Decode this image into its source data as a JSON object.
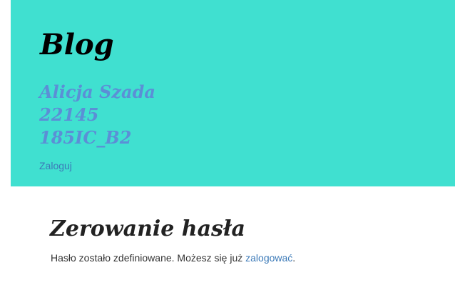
{
  "header": {
    "blog_title": "Blog",
    "author_lines": [
      "Alicja Szada",
      "22145",
      "185IC_B2"
    ],
    "login_link": "Zaloguj",
    "background_color": "#40e0d0"
  },
  "main": {
    "title": "Zerowanie hasła",
    "message_prefix": "Hasło zostało zdefiniowane. Możesz się już ",
    "message_link": "zalogować",
    "message_suffix": "."
  }
}
